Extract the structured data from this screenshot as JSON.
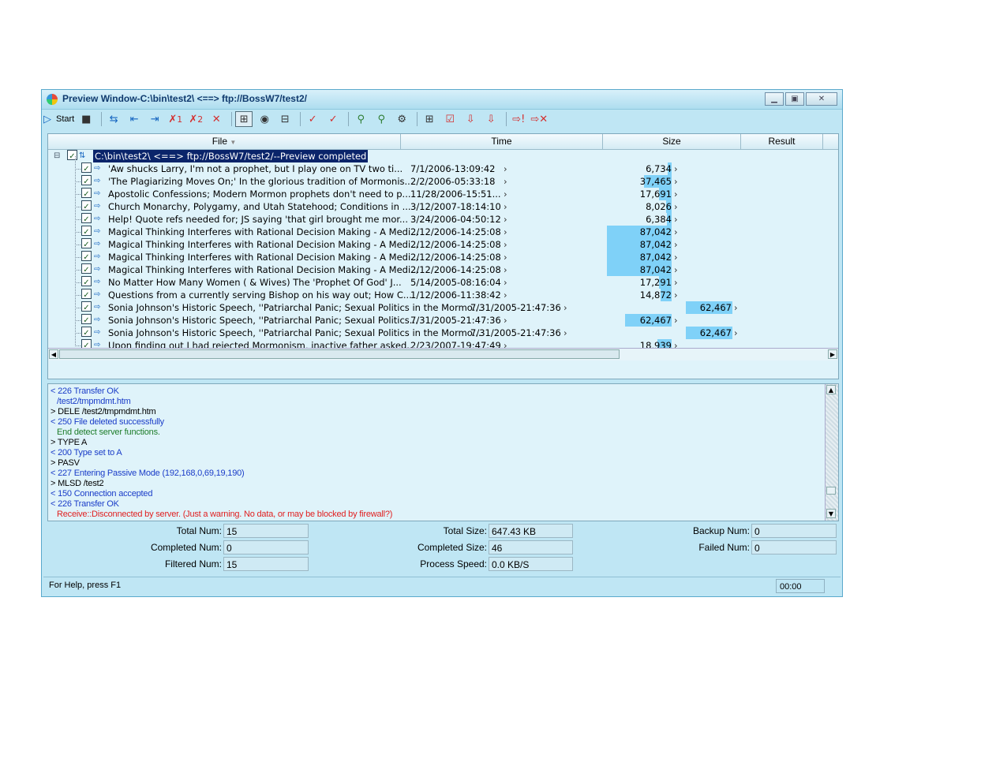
{
  "window": {
    "title": "Preview Window-C:\\bin\\test2\\ <==> ftp://BossW7/test2/"
  },
  "toolbar": {
    "start_label": "Start",
    "x1": "1",
    "x2": "2"
  },
  "columns": [
    "File",
    "Time",
    "Size",
    "Result"
  ],
  "root": {
    "label": "C:\\bin\\test2\\ <==> ftp://BossW7/test2/--Preview completed"
  },
  "files": [
    {
      "name": "'Aw shucks Larry, I'm not a prophet, but I play one on TV two ti...",
      "time": "7/1/2006-13:09:42",
      "size": "6,734",
      "size2": "",
      "bar": 0.06
    },
    {
      "name": "'The Plagiarizing Moves On;' In the glorious tradition of Mormonis...",
      "time": "2/2/2006-05:33:18",
      "size": "37,465",
      "size2": "",
      "bar": 0.43
    },
    {
      "name": "Apostolic Confessions; Modern Mormon prophets don't need to p...",
      "time": "11/28/2006-15:51...",
      "size": "17,691",
      "size2": "",
      "bar": 0.2
    },
    {
      "name": "Church Monarchy, Polygamy, and Utah Statehood; Conditions in ...",
      "time": "3/12/2007-18:14:10",
      "size": "8,026",
      "size2": "",
      "bar": 0.09
    },
    {
      "name": "Help! Quote refs needed for; JS saying 'that girl brought me mor...",
      "time": "3/24/2006-04:50:12",
      "size": "6,384",
      "size2": "",
      "bar": 0.07
    },
    {
      "name": "Magical Thinking Interferes with Rational Decision Making - A Medi...",
      "time": "2/12/2006-14:25:08",
      "size": "87,042",
      "size2": "",
      "bar": 1.0
    },
    {
      "name": "Magical Thinking Interferes with Rational Decision Making - A Medi...",
      "time": "2/12/2006-14:25:08",
      "size": "87,042",
      "size2": "",
      "bar": 1.0
    },
    {
      "name": "Magical Thinking Interferes with Rational Decision Making - A Medi...",
      "time": "2/12/2006-14:25:08",
      "size": "87,042",
      "size2": "",
      "bar": 1.0
    },
    {
      "name": "Magical Thinking Interferes with Rational Decision Making - A Medi...",
      "time": "2/12/2006-14:25:08",
      "size": "87,042",
      "size2": "",
      "bar": 1.0
    },
    {
      "name": "No Matter How Many Women ( & Wives) The 'Prophet Of God' J...",
      "time": "5/14/2005-08:16:04",
      "size": "17,291",
      "size2": "",
      "bar": 0.2
    },
    {
      "name": "Questions from a currently serving Bishop on his way out; How C...",
      "time": "1/12/2006-11:38:42",
      "size": "14,872",
      "size2": "",
      "bar": 0.17
    },
    {
      "name": "Sonia Johnson's Historic Speech, ''Patriarchal Panic; Sexual Politics in the Mormo...",
      "time": "7/31/2005-21:47:36",
      "size": "",
      "size2": "62,467",
      "bar": 0.72
    },
    {
      "name": "Sonia Johnson's Historic Speech, ''Patriarchal Panic; Sexual Politics...",
      "time": "7/31/2005-21:47:36",
      "size": "62,467",
      "size2": "",
      "bar": 0.72
    },
    {
      "name": "Sonia Johnson's Historic Speech, ''Patriarchal Panic; Sexual Politics in the Mormo...",
      "time": "7/31/2005-21:47:36",
      "size": "",
      "size2": "62,467",
      "bar": 0.72
    },
    {
      "name": "Upon finding out I had rejected Mormonism, inactive father asked...",
      "time": "2/23/2007-19:47:49",
      "size": "18,939",
      "size2": "",
      "bar": 0.22
    }
  ],
  "log": [
    {
      "text": "< 226 Transfer OK",
      "color": "#1a3cc8",
      "indent": false
    },
    {
      "text": "/test2/tmpmdmt.htm",
      "color": "#1a3cc8",
      "indent": true
    },
    {
      "text": "> DELE /test2/tmpmdmt.htm",
      "color": "#000000",
      "indent": false
    },
    {
      "text": "< 250 File deleted successfully",
      "color": "#1a3cc8",
      "indent": false
    },
    {
      "text": "End detect server functions.",
      "color": "#1e7d2a",
      "indent": true
    },
    {
      "text": "> TYPE A",
      "color": "#000000",
      "indent": false
    },
    {
      "text": "< 200 Type set to A",
      "color": "#1a3cc8",
      "indent": false
    },
    {
      "text": "> PASV",
      "color": "#000000",
      "indent": false
    },
    {
      "text": "< 227 Entering Passive Mode (192,168,0,69,19,190)",
      "color": "#1a3cc8",
      "indent": false
    },
    {
      "text": "> MLSD /test2",
      "color": "#000000",
      "indent": false
    },
    {
      "text": "< 150 Connection accepted",
      "color": "#1a3cc8",
      "indent": false
    },
    {
      "text": "< 226 Transfer OK",
      "color": "#1a3cc8",
      "indent": false
    },
    {
      "text": "Receive::Disconnected by server. (Just a warning. No data, or may be blocked by firewall?)",
      "color": "#e02020",
      "indent": true
    }
  ],
  "stats": {
    "total_num_label": "Total Num:",
    "total_num": "15",
    "completed_num_label": "Completed Num:",
    "completed_num": "0",
    "filtered_num_label": "Filtered Num:",
    "filtered_num": "15",
    "total_size_label": "Total Size:",
    "total_size": "647.43 KB",
    "completed_size_label": "Completed Size:",
    "completed_size": "46",
    "process_speed_label": "Process Speed:",
    "process_speed": "0.0 KB/S",
    "backup_num_label": "Backup Num:",
    "backup_num": "0",
    "failed_num_label": "Failed Num:",
    "failed_num": "0"
  },
  "statusbar": {
    "help": "For Help, press F1",
    "time": "00:00"
  }
}
